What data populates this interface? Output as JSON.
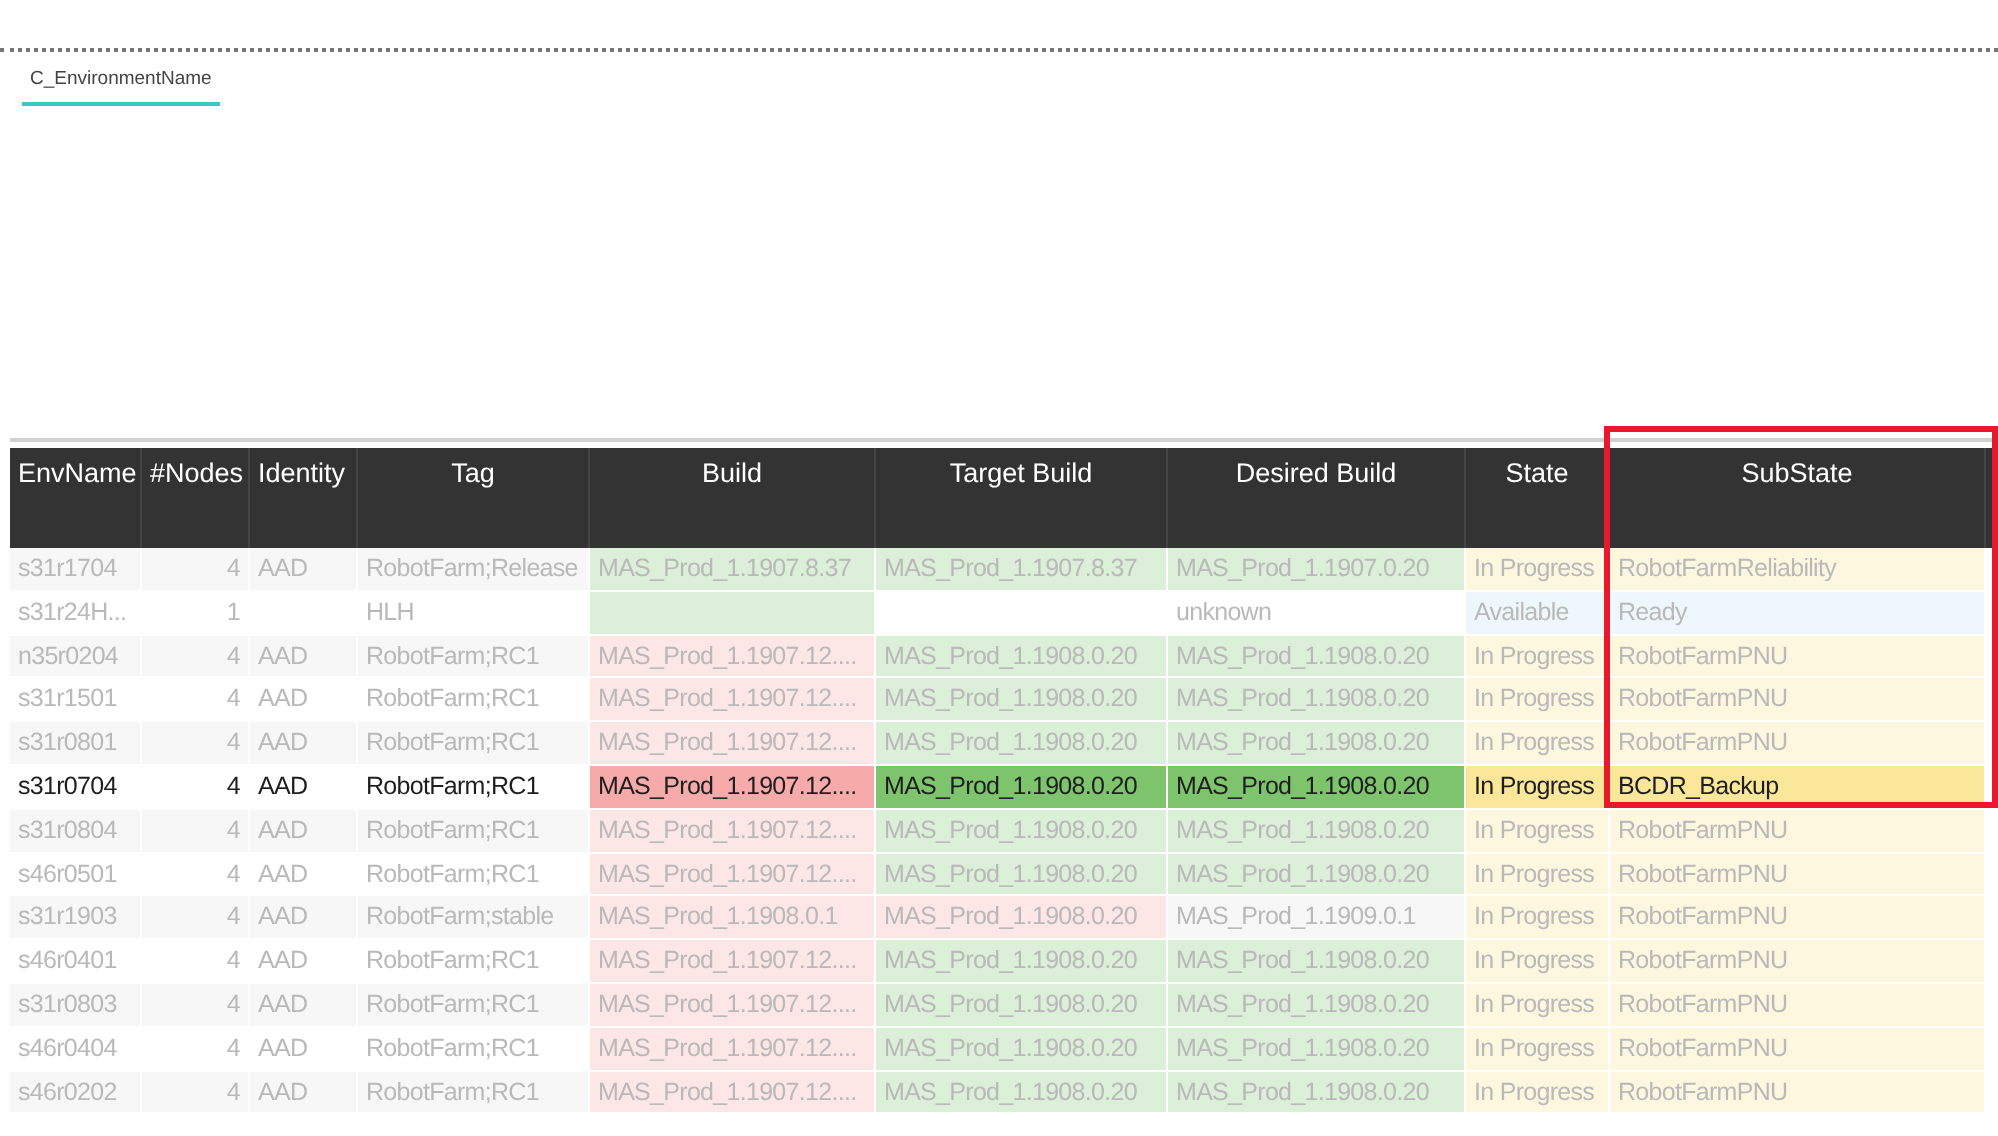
{
  "tabs": [
    {
      "label": "C_EnvironmentName",
      "selected": true
    }
  ],
  "table": {
    "columns": [
      {
        "label": "EnvName",
        "framed": false
      },
      {
        "label": "#Nodes",
        "framed": false
      },
      {
        "label": "Identity",
        "framed": false
      },
      {
        "label": "Tag",
        "framed": false
      },
      {
        "label": "Build",
        "framed": false
      },
      {
        "label": "Target Build",
        "framed": false
      },
      {
        "label": "Desired Build",
        "framed": false
      },
      {
        "label": "State",
        "framed": false
      },
      {
        "label": "SubState",
        "framed": true
      }
    ],
    "rows": [
      {
        "selected": false,
        "cells": [
          {
            "text": "s31r1704"
          },
          {
            "text": "4"
          },
          {
            "text": "AAD"
          },
          {
            "text": "RobotFarm;Release"
          },
          {
            "text": "MAS_Prod_1.1907.8.37",
            "color": "#dcefd8"
          },
          {
            "text": "MAS_Prod_1.1907.8.37",
            "color": "#dcefd8"
          },
          {
            "text": "MAS_Prod_1.1907.0.20",
            "color": "#dcefd8"
          },
          {
            "text": "In Progress",
            "color": "#fef7e0"
          },
          {
            "text": "RobotFarmReliability",
            "color": "#fef7e0"
          }
        ]
      },
      {
        "selected": false,
        "cells": [
          {
            "text": "s31r24H..."
          },
          {
            "text": "1"
          },
          {},
          {
            "text": "HLH"
          },
          {
            "color": "#dcefd8"
          },
          {},
          {
            "text": "unknown"
          },
          {
            "text": "Available",
            "color": "#eef8fc"
          },
          {
            "text": "Ready",
            "color": "#eef8fc"
          }
        ]
      },
      {
        "selected": false,
        "cells": [
          {
            "text": "n35r0204"
          },
          {
            "text": "4"
          },
          {
            "text": "AAD"
          },
          {
            "text": "RobotFarm;RC1"
          },
          {
            "text": "MAS_Prod_1.1907.12....",
            "color": "#fde6e6"
          },
          {
            "text": "MAS_Prod_1.1908.0.20",
            "color": "#dcefd8"
          },
          {
            "text": "MAS_Prod_1.1908.0.20",
            "color": "#dcefd8"
          },
          {
            "text": "In Progress",
            "color": "#fef7e0"
          },
          {
            "text": "RobotFarmPNU",
            "color": "#fef7e0"
          }
        ]
      },
      {
        "selected": false,
        "cells": [
          {
            "text": "s31r1501"
          },
          {
            "text": "4"
          },
          {
            "text": "AAD"
          },
          {
            "text": "RobotFarm;RC1"
          },
          {
            "text": "MAS_Prod_1.1907.12....",
            "color": "#fde6e6"
          },
          {
            "text": "MAS_Prod_1.1908.0.20",
            "color": "#dcefd8"
          },
          {
            "text": "MAS_Prod_1.1908.0.20",
            "color": "#dcefd8"
          },
          {
            "text": "In Progress",
            "color": "#fef7e0"
          },
          {
            "text": "RobotFarmPNU",
            "color": "#fef7e0"
          }
        ]
      },
      {
        "selected": false,
        "cells": [
          {
            "text": "s31r0801"
          },
          {
            "text": "4"
          },
          {
            "text": "AAD"
          },
          {
            "text": "RobotFarm;RC1"
          },
          {
            "text": "MAS_Prod_1.1907.12....",
            "color": "#fde6e6"
          },
          {
            "text": "MAS_Prod_1.1908.0.20",
            "color": "#dcefd8"
          },
          {
            "text": "MAS_Prod_1.1908.0.20",
            "color": "#dcefd8"
          },
          {
            "text": "In Progress",
            "color": "#fef7e0"
          },
          {
            "text": "RobotFarmPNU",
            "color": "#fef7e0"
          }
        ]
      },
      {
        "selected": true,
        "cells": [
          {
            "text": "s31r0704"
          },
          {
            "text": "4"
          },
          {
            "text": "AAD"
          },
          {
            "text": "RobotFarm;RC1"
          },
          {
            "text": "MAS_Prod_1.1907.12....",
            "color": "#f6abaa"
          },
          {
            "text": "MAS_Prod_1.1908.0.20",
            "color": "#7ec46c"
          },
          {
            "text": "MAS_Prod_1.1908.0.20",
            "color": "#7ec46c"
          },
          {
            "text": "In Progress",
            "color": "#fbe79a"
          },
          {
            "text": "BCDR_Backup",
            "color": "#fbe79a"
          }
        ]
      },
      {
        "selected": false,
        "cells": [
          {
            "text": "s31r0804"
          },
          {
            "text": "4"
          },
          {
            "text": "AAD"
          },
          {
            "text": "RobotFarm;RC1"
          },
          {
            "text": "MAS_Prod_1.1907.12....",
            "color": "#fde6e6"
          },
          {
            "text": "MAS_Prod_1.1908.0.20",
            "color": "#dcefd8"
          },
          {
            "text": "MAS_Prod_1.1908.0.20",
            "color": "#dcefd8"
          },
          {
            "text": "In Progress",
            "color": "#fef7e0"
          },
          {
            "text": "RobotFarmPNU",
            "color": "#fef7e0"
          }
        ]
      },
      {
        "selected": false,
        "cells": [
          {
            "text": "s46r0501"
          },
          {
            "text": "4"
          },
          {
            "text": "AAD"
          },
          {
            "text": "RobotFarm;RC1"
          },
          {
            "text": "MAS_Prod_1.1907.12....",
            "color": "#fde6e6"
          },
          {
            "text": "MAS_Prod_1.1908.0.20",
            "color": "#dcefd8"
          },
          {
            "text": "MAS_Prod_1.1908.0.20",
            "color": "#dcefd8"
          },
          {
            "text": "In Progress",
            "color": "#fef7e0"
          },
          {
            "text": "RobotFarmPNU",
            "color": "#fef7e0"
          }
        ]
      },
      {
        "selected": false,
        "cells": [
          {
            "text": "s31r1903"
          },
          {
            "text": "4"
          },
          {
            "text": "AAD"
          },
          {
            "text": "RobotFarm;stable"
          },
          {
            "text": "MAS_Prod_1.1908.0.1",
            "color": "#fde6e6"
          },
          {
            "text": "MAS_Prod_1.1908.0.20",
            "color": "#fde6e6"
          },
          {
            "text": "MAS_Prod_1.1909.0.1"
          },
          {
            "text": "In Progress",
            "color": "#fef7e0"
          },
          {
            "text": "RobotFarmPNU",
            "color": "#fef7e0"
          }
        ]
      },
      {
        "selected": false,
        "cells": [
          {
            "text": "s46r0401"
          },
          {
            "text": "4"
          },
          {
            "text": "AAD"
          },
          {
            "text": "RobotFarm;RC1"
          },
          {
            "text": "MAS_Prod_1.1907.12....",
            "color": "#fde6e6"
          },
          {
            "text": "MAS_Prod_1.1908.0.20",
            "color": "#dcefd8"
          },
          {
            "text": "MAS_Prod_1.1908.0.20",
            "color": "#dcefd8"
          },
          {
            "text": "In Progress",
            "color": "#fef7e0"
          },
          {
            "text": "RobotFarmPNU",
            "color": "#fef7e0"
          }
        ]
      },
      {
        "selected": false,
        "cells": [
          {
            "text": "s31r0803"
          },
          {
            "text": "4"
          },
          {
            "text": "AAD"
          },
          {
            "text": "RobotFarm;RC1"
          },
          {
            "text": "MAS_Prod_1.1907.12....",
            "color": "#fde6e6"
          },
          {
            "text": "MAS_Prod_1.1908.0.20",
            "color": "#dcefd8"
          },
          {
            "text": "MAS_Prod_1.1908.0.20",
            "color": "#dcefd8"
          },
          {
            "text": "In Progress",
            "color": "#fef7e0"
          },
          {
            "text": "RobotFarmPNU",
            "color": "#fef7e0"
          }
        ]
      },
      {
        "selected": false,
        "cells": [
          {
            "text": "s46r0404"
          },
          {
            "text": "4"
          },
          {
            "text": "AAD"
          },
          {
            "text": "RobotFarm;RC1"
          },
          {
            "text": "MAS_Prod_1.1907.12....",
            "color": "#fde6e6"
          },
          {
            "text": "MAS_Prod_1.1908.0.20",
            "color": "#dcefd8"
          },
          {
            "text": "MAS_Prod_1.1908.0.20",
            "color": "#dcefd8"
          },
          {
            "text": "In Progress",
            "color": "#fef7e0"
          },
          {
            "text": "RobotFarmPNU",
            "color": "#fef7e0"
          }
        ]
      },
      {
        "selected": false,
        "cells": [
          {
            "text": "s46r0202"
          },
          {
            "text": "4"
          },
          {
            "text": "AAD"
          },
          {
            "text": "RobotFarm;RC1"
          },
          {
            "text": "MAS_Prod_1.1907.12....",
            "color": "#fde6e6"
          },
          {
            "text": "MAS_Prod_1.1908.0.20",
            "color": "#dcefd8"
          },
          {
            "text": "MAS_Prod_1.1908.0.20",
            "color": "#dcefd8"
          },
          {
            "text": "In Progress",
            "color": "#fef7e0"
          },
          {
            "text": "RobotFarmPNU",
            "color": "#fef7e0"
          }
        ]
      }
    ]
  }
}
